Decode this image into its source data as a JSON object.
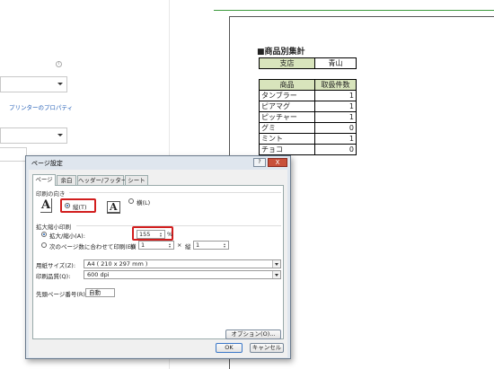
{
  "backstage": {
    "printer_properties_link": "プリンターのプロパティ",
    "info_icon": "i"
  },
  "report": {
    "title": "■商品別集計",
    "store_header": "支店",
    "store_value": "青山",
    "goods_header_name": "商品",
    "goods_header_count": "取扱件数",
    "rows": [
      {
        "name": "タンブラー",
        "count": "1"
      },
      {
        "name": "ピアマグ",
        "count": "1"
      },
      {
        "name": "ピッチャー",
        "count": "1"
      },
      {
        "name": "グミ",
        "count": "0"
      },
      {
        "name": "ミント",
        "count": "1"
      },
      {
        "name": "チョコ",
        "count": "0"
      }
    ]
  },
  "dialog": {
    "title": "ページ設定",
    "help_label": "?",
    "close_label": "X",
    "tabs": [
      "ページ",
      "余白",
      "ヘッダー/フッター",
      "シート"
    ],
    "orientation": {
      "group_label": "印刷の向き",
      "portrait_label": "縦(T)",
      "landscape_label": "横(L)",
      "glyph": "A"
    },
    "scaling": {
      "group_label": "拡大縮小印刷",
      "zoom_label": "拡大/縮小(A):",
      "zoom_value": "155",
      "zoom_unit": "%",
      "fit_label": "次のページ数に合わせて印刷(E):",
      "wide_label": "横",
      "wide_value": "1",
      "times": "×",
      "tall_label": "縦",
      "tall_value": "1"
    },
    "paper_size_label": "用紙サイズ(Z):",
    "paper_size_value": "A4 ( 210 x 297 mm )",
    "print_quality_label": "印刷品質(Q):",
    "print_quality_value": "600 dpi",
    "first_page_label": "先頭ページ番号(R):",
    "first_page_value": "自動",
    "options_button": "オプション(O)...",
    "ok_button": "OK",
    "cancel_button": "キャンセル"
  }
}
